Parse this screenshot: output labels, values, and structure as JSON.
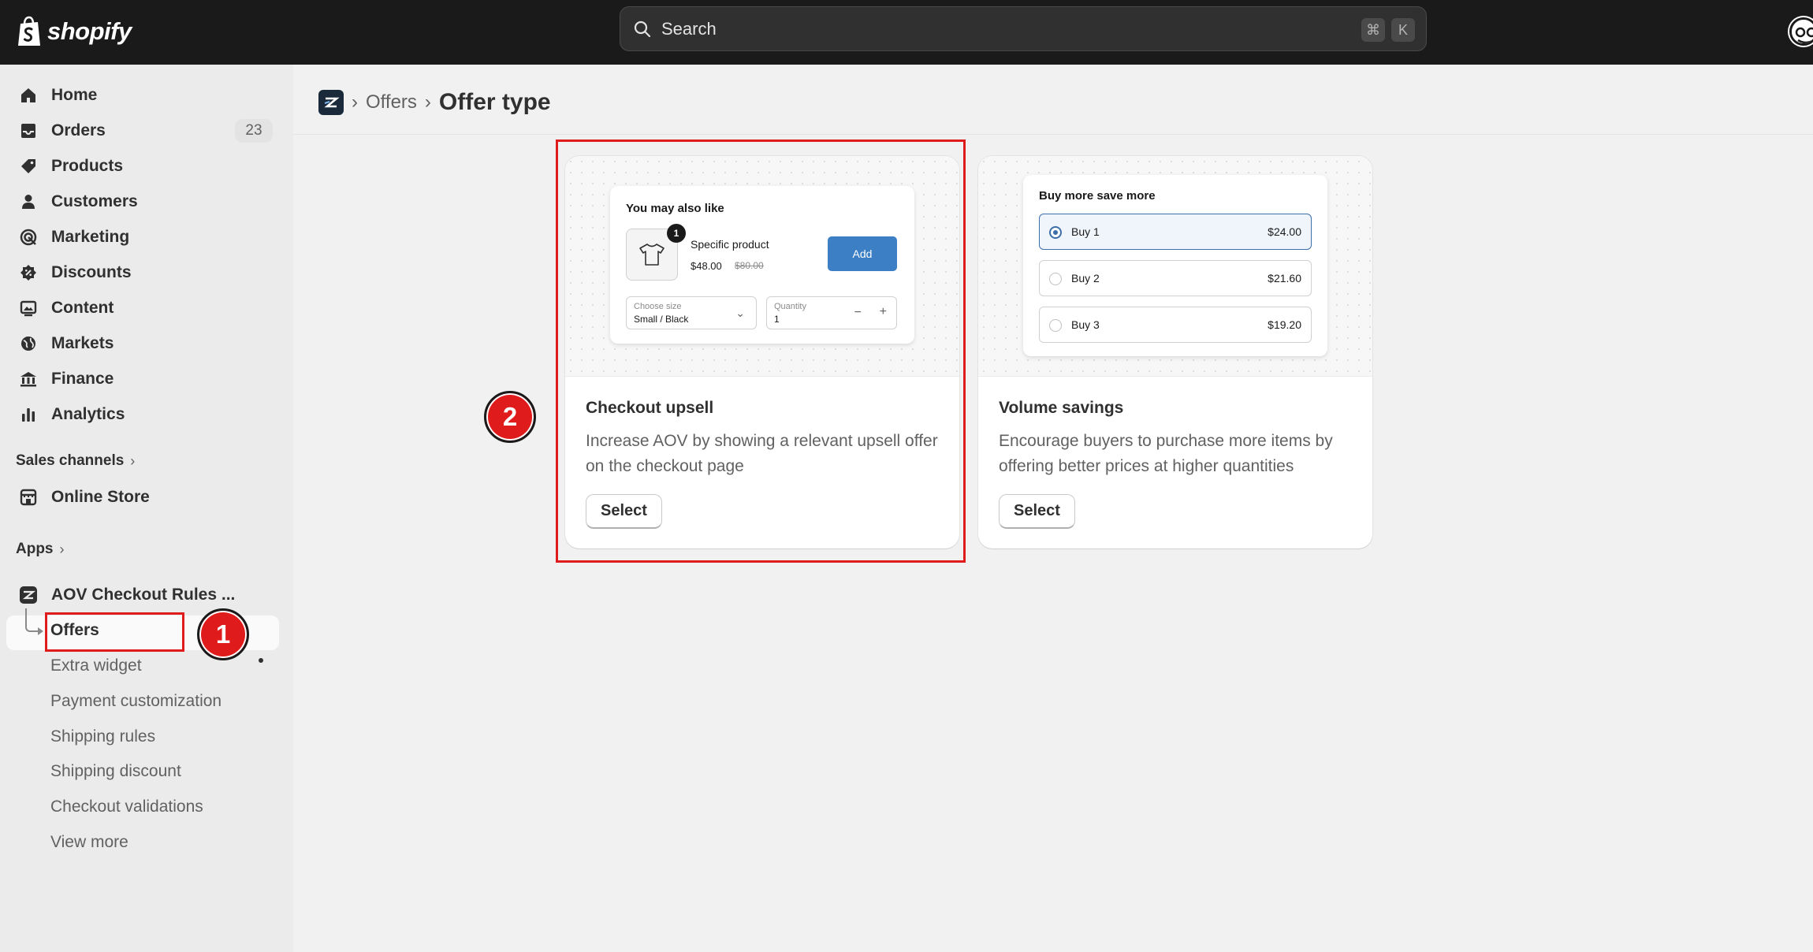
{
  "topbar": {
    "logo_text": "shopify",
    "search_placeholder": "Search",
    "shortcut_cmd": "⌘",
    "shortcut_key": "K"
  },
  "sidebar": {
    "items": [
      {
        "label": "Home",
        "icon": "home-icon"
      },
      {
        "label": "Orders",
        "icon": "inbox-icon",
        "badge": "23"
      },
      {
        "label": "Products",
        "icon": "tag-icon"
      },
      {
        "label": "Customers",
        "icon": "person-icon"
      },
      {
        "label": "Marketing",
        "icon": "target-icon"
      },
      {
        "label": "Discounts",
        "icon": "discount-icon"
      },
      {
        "label": "Content",
        "icon": "image-icon"
      },
      {
        "label": "Markets",
        "icon": "globe-icon"
      },
      {
        "label": "Finance",
        "icon": "bank-icon"
      },
      {
        "label": "Analytics",
        "icon": "chart-icon"
      }
    ],
    "sales_channels_label": "Sales channels",
    "online_store_label": "Online Store",
    "apps_label": "Apps",
    "app_name": "AOV Checkout Rules ...",
    "app_subitems": [
      "Offers",
      "Extra widget",
      "Payment customization",
      "Shipping rules",
      "Shipping discount",
      "Checkout validations",
      "View more"
    ]
  },
  "breadcrumb": {
    "parent": "Offers",
    "title": "Offer type"
  },
  "cards": [
    {
      "title": "Checkout upsell",
      "description": "Increase AOV by showing a relevant upsell offer on the checkout page",
      "button": "Select",
      "preview": {
        "heading": "You may also like",
        "quantity_badge": "1",
        "product_name": "Specific product",
        "price": "$48.00",
        "compare_price": "$80.00",
        "add_label": "Add",
        "size_label": "Choose size",
        "size_value": "Small / Black",
        "qty_label": "Quantity",
        "qty_value": "1"
      }
    },
    {
      "title": "Volume savings",
      "description": "Encourage buyers to purchase more items by offering better prices at higher quantities",
      "button": "Select",
      "preview": {
        "heading": "Buy more save more",
        "options": [
          {
            "label": "Buy 1",
            "price": "$24.00",
            "selected": true
          },
          {
            "label": "Buy 2",
            "price": "$21.60",
            "selected": false
          },
          {
            "label": "Buy 3",
            "price": "$19.20",
            "selected": false
          }
        ]
      }
    }
  ],
  "annotations": {
    "step1": "1",
    "step2": "2",
    "highlight_color": "#e01b1b"
  }
}
